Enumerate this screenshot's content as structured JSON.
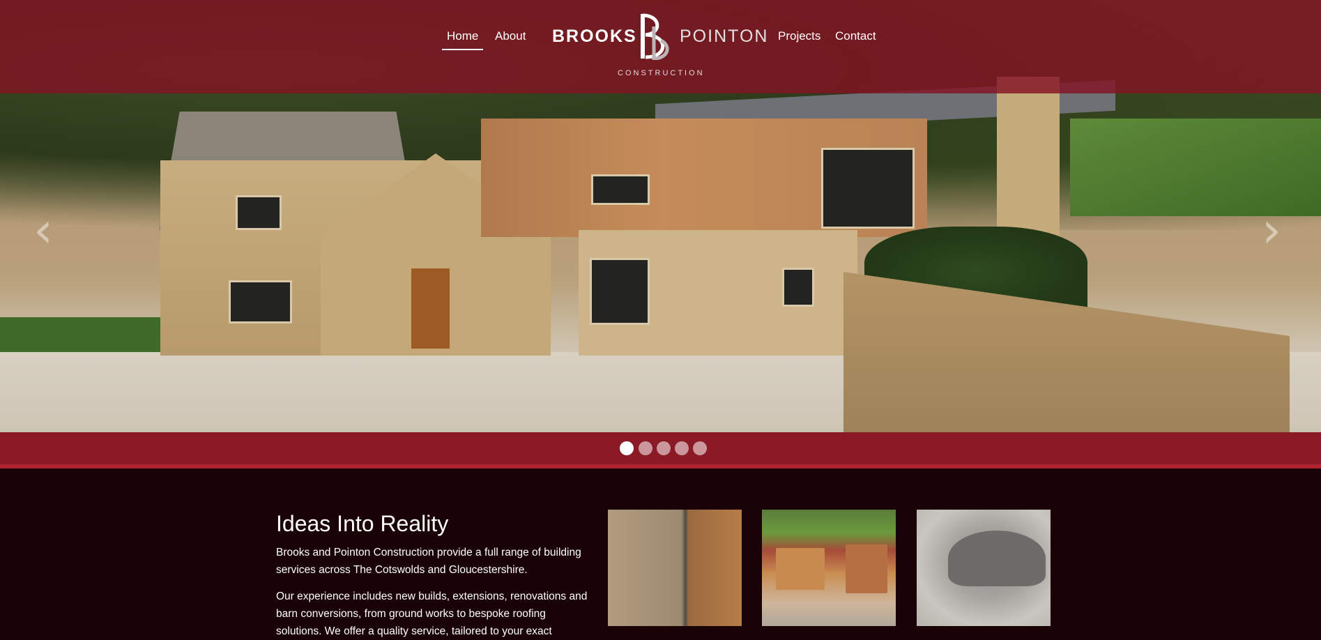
{
  "nav": {
    "left": [
      {
        "label": "Home",
        "active": true
      },
      {
        "label": "About"
      }
    ],
    "right": [
      {
        "label": "Projects"
      },
      {
        "label": "Contact"
      }
    ]
  },
  "logo": {
    "left_word": "BROOKS",
    "right_word": "POINTON",
    "subtitle": "CONSTRUCTION"
  },
  "carousel": {
    "slide_count": 5,
    "active_index": 0
  },
  "intro": {
    "heading": "Ideas Into Reality",
    "paragraph1": "Brooks and Pointon Construction provide a full range of building services across The Cotswolds and Gloucestershire.",
    "paragraph2": "Our experience includes new builds, extensions, renovations and barn conversions, from ground works to bespoke roofing solutions. We offer a quality service, tailored to your exact"
  },
  "colors": {
    "brand_red": "#82141f",
    "background": "#1a0306"
  }
}
